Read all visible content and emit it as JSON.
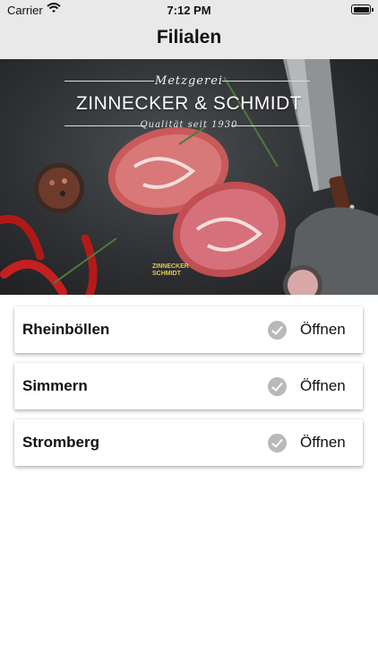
{
  "status_bar": {
    "carrier": "Carrier",
    "time": "7:12 PM",
    "wifi_icon": "wifi-icon",
    "battery_icon": "battery-icon"
  },
  "navbar": {
    "title": "Filialen"
  },
  "hero": {
    "brand_top": "Metzgerei",
    "brand_name": "ZINNECKER & SCHMIDT",
    "brand_sub": "Qualität seit 1930",
    "logo_line1": "ZINNECKER",
    "logo_line2": "SCHMIDT"
  },
  "branches": [
    {
      "name": "Rheinböllen",
      "status_icon": "checkmark-circle-icon",
      "action": "Öffnen"
    },
    {
      "name": "Simmern",
      "status_icon": "checkmark-circle-icon",
      "action": "Öffnen"
    },
    {
      "name": "Stromberg",
      "status_icon": "checkmark-circle-icon",
      "action": "Öffnen"
    }
  ],
  "colors": {
    "bar_background": "#e9e9e9",
    "check_grey": "#b9b9b9",
    "logo_yellow": "#e1c94b"
  }
}
